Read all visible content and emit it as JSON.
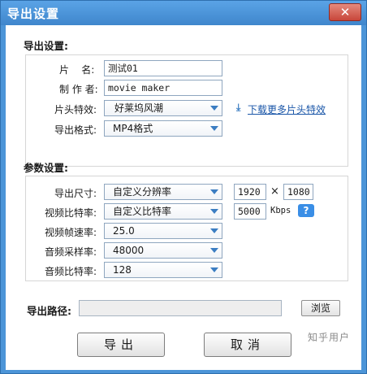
{
  "window": {
    "title": "导出设置",
    "close_glyph": "✕"
  },
  "export_settings": {
    "section_title": "导出设置:",
    "film_name": {
      "label": "片    名:",
      "value": "测试01"
    },
    "author": {
      "label": "制 作 者:",
      "value": "movie maker"
    },
    "intro_effect": {
      "label": "片头特效:",
      "value": "好莱坞风潮"
    },
    "download_link": "下载更多片头特效",
    "format": {
      "label": "导出格式:",
      "value": "MP4格式"
    }
  },
  "param_settings": {
    "section_title": "参数设置:",
    "size": {
      "label": "导出尺寸:",
      "value": "自定义分辨率",
      "width": "1920",
      "times": "×",
      "height": "1080"
    },
    "video_bitrate": {
      "label": "视频比特率:",
      "value": "自定义比特率",
      "custom": "5000",
      "unit": "Kbps",
      "help": "?"
    },
    "frame_rate": {
      "label": "视频帧速率:",
      "value": "25.0"
    },
    "audio_sample": {
      "label": "音频采样率:",
      "value": "48000"
    },
    "audio_bitrate": {
      "label": "音频比特率:",
      "value": "128"
    }
  },
  "output": {
    "label": "导出路径:",
    "path": "",
    "browse": "浏览"
  },
  "buttons": {
    "export": "导出",
    "cancel": "取消"
  },
  "watermark": "知乎用户"
}
